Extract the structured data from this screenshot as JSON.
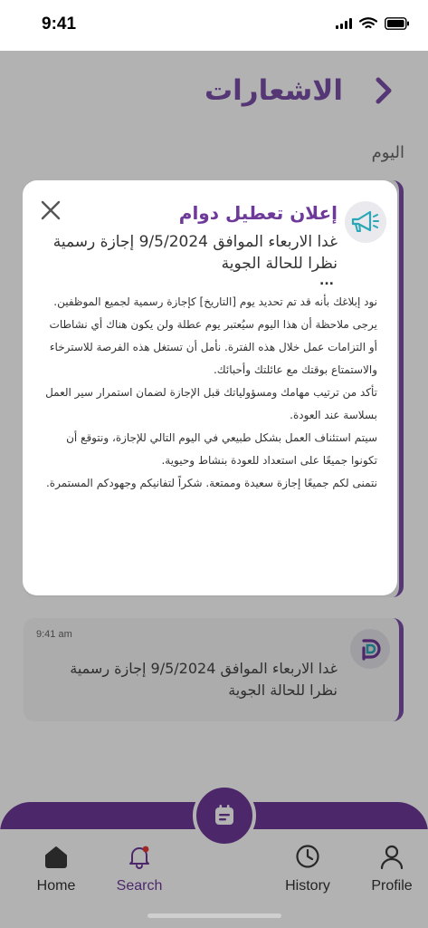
{
  "status_bar": {
    "time": "9:41"
  },
  "header": {
    "title": "الاشعارات"
  },
  "section_label": "اليوم",
  "notifications": [
    {
      "time": "",
      "text": ""
    },
    {
      "time": "9:41 am",
      "text": "غدا الاربعاء الموافق 9/5/2024 إجازة رسمية نظرا للحالة الجوية"
    }
  ],
  "modal": {
    "title": "إعلان تعطيل دوام",
    "subtitle": "غدا الاربعاء الموافق 9/5/2024 إجازة رسمية نظرا للحالة الجوية",
    "ellipsis": "...",
    "body": [
      "نود إبلاغك بأنه قد تم تحديد يوم [التاريخ] كإجازة رسمية لجميع الموظفين. يرجى ملاحظة أن هذا اليوم سيُعتبر يوم عطلة ولن يكون هناك أي نشاطات أو التزامات عمل خلال هذه الفترة. نأمل أن تستغل هذه الفرصة للاسترخاء والاستمتاع بوقتك مع عائلتك وأحبائك.",
      "تأكد من ترتيب مهامك ومسؤولياتك قبل الإجازة لضمان استمرار سير العمل بسلاسة عند العودة.",
      "سيتم استئناف العمل بشكل طبيعي في اليوم التالي للإجازة، ونتوقع أن تكونوا جميعًا على استعداد للعودة بنشاط وحيوية.",
      "نتمنى لكم جميعًا إجازة سعيدة وممتعة. شكراً لتفانيكم وجهودكم المستمرة."
    ]
  },
  "nav": {
    "items": [
      {
        "label": "Home",
        "icon": "home-icon",
        "active": false
      },
      {
        "label": "Search",
        "icon": "bell-icon",
        "active": true
      },
      {
        "label": "History",
        "icon": "clock-icon",
        "active": false
      },
      {
        "label": "Profile",
        "icon": "user-icon",
        "active": false
      }
    ],
    "center_icon": "calendar-icon"
  },
  "colors": {
    "accent": "#6e3a99",
    "title": "#7a4fa8",
    "notification_dot": "#e53935",
    "icon_teal": "#2aa7b6"
  }
}
